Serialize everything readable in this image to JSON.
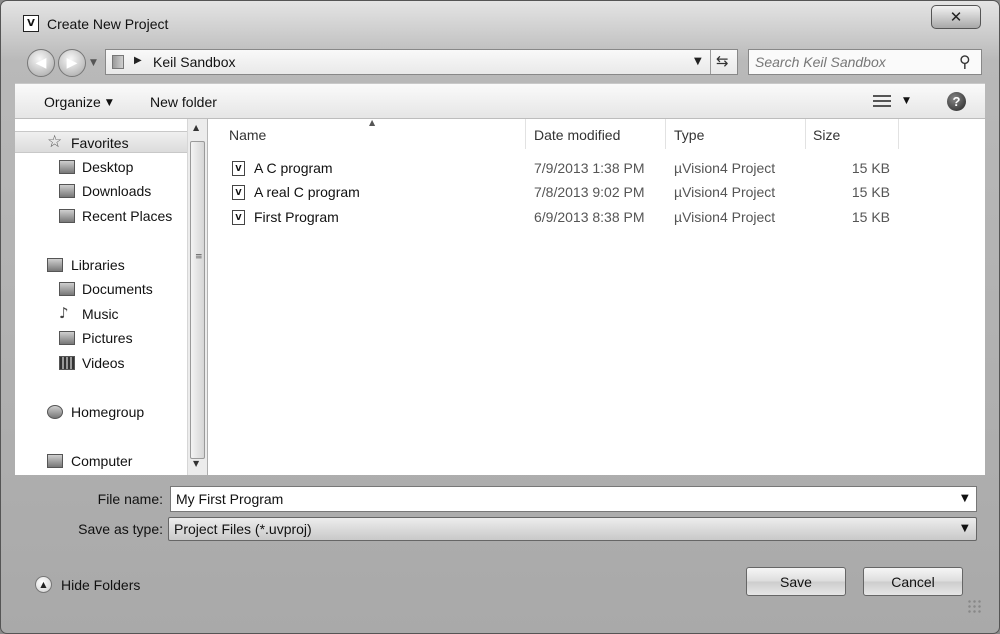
{
  "window": {
    "title": "Create New Project",
    "app_icon_glyph": "V",
    "close_glyph": "✕"
  },
  "nav": {
    "back_glyph": "◀",
    "forward_glyph": "▶",
    "address": {
      "current_folder": "Keil Sandbox",
      "breadcrumb_arrow": "▶"
    },
    "search_placeholder": "Search Keil Sandbox"
  },
  "toolbar": {
    "organize_label": "Organize",
    "new_folder_label": "New folder",
    "help_glyph": "?"
  },
  "navpane": {
    "favorites": {
      "label": "Favorites",
      "items": [
        {
          "label": "Desktop",
          "icon": "desktop-icon"
        },
        {
          "label": "Downloads",
          "icon": "downloads-icon"
        },
        {
          "label": "Recent Places",
          "icon": "recent-places-icon"
        }
      ]
    },
    "libraries": {
      "label": "Libraries",
      "items": [
        {
          "label": "Documents",
          "icon": "documents-icon"
        },
        {
          "label": "Music",
          "icon": "music-icon"
        },
        {
          "label": "Pictures",
          "icon": "pictures-icon"
        },
        {
          "label": "Videos",
          "icon": "videos-icon"
        }
      ]
    },
    "homegroup_label": "Homegroup",
    "computer_label": "Computer"
  },
  "filelist": {
    "columns": [
      "Name",
      "Date modified",
      "Type",
      "Size"
    ],
    "rows": [
      {
        "name": "A C program",
        "date": "7/9/2013 1:38 PM",
        "type": "µVision4 Project",
        "size": "15 KB"
      },
      {
        "name": "A real C program",
        "date": "7/8/2013 9:02 PM",
        "type": "µVision4 Project",
        "size": "15 KB"
      },
      {
        "name": "First Program",
        "date": "6/9/2013 8:38 PM",
        "type": "µVision4 Project",
        "size": "15 KB"
      }
    ]
  },
  "form": {
    "filename_label": "File name:",
    "filename_value": "My First Program",
    "savetype_label": "Save as type:",
    "savetype_value": "Project Files (*.uvproj)"
  },
  "footer": {
    "hide_folders_label": "Hide Folders",
    "save_label": "Save",
    "cancel_label": "Cancel"
  }
}
